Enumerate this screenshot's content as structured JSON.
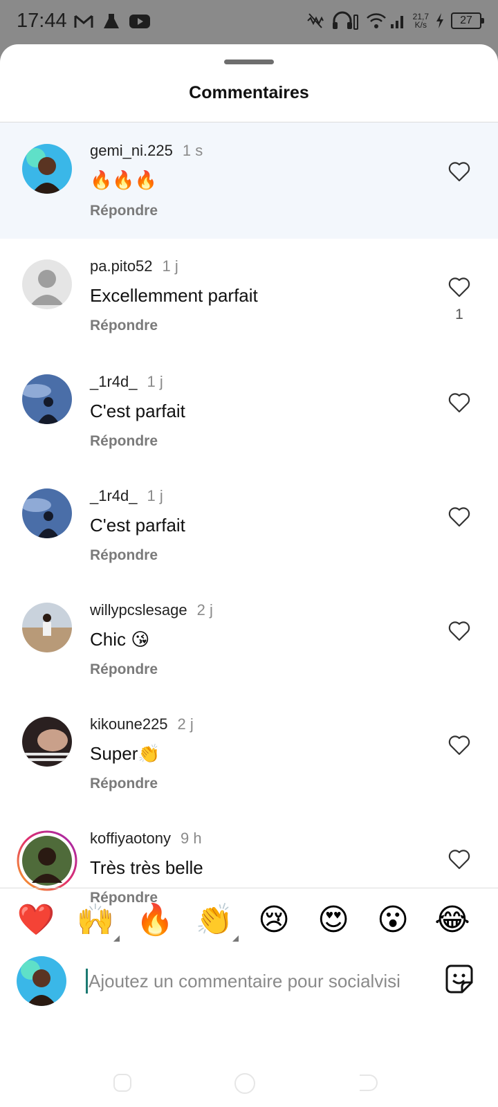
{
  "status_bar": {
    "time": "17:44",
    "net_speed_value": "21,7",
    "net_speed_unit": "K/s",
    "battery": "27"
  },
  "sheet": {
    "title": "Commentaires"
  },
  "comments": [
    {
      "username": "gemi_ni.225",
      "time": "1 s",
      "text": "🔥🔥🔥",
      "reply": "Répondre",
      "likes": ""
    },
    {
      "username": "pa.pito52",
      "time": "1 j",
      "text": "Excellemment parfait",
      "reply": "Répondre",
      "likes": "1"
    },
    {
      "username": "_1r4d_",
      "time": "1 j",
      "text": "C'est parfait",
      "reply": "Répondre",
      "likes": ""
    },
    {
      "username": "_1r4d_",
      "time": "1 j",
      "text": "C'est parfait",
      "reply": "Répondre",
      "likes": ""
    },
    {
      "username": "willypcslesage",
      "time": "2 j",
      "text": "Chic 😘",
      "reply": "Répondre",
      "likes": ""
    },
    {
      "username": "kikoune225",
      "time": "2 j",
      "text": "Super👏",
      "reply": "Répondre",
      "likes": ""
    },
    {
      "username": "koffiyaotony",
      "time": "9 h",
      "text": "Très très belle",
      "reply": "Répondre",
      "likes": ""
    }
  ],
  "reactions": [
    "❤️",
    "🙌",
    "🔥",
    "👏",
    "😢",
    "😍",
    "😮",
    "😂"
  ],
  "composer": {
    "placeholder": "Ajoutez un commentaire pour socialvisi"
  },
  "colors": {
    "highlight": "#f3f7fc",
    "story_ring": "#e1306c",
    "caret": "#1c7a72"
  }
}
